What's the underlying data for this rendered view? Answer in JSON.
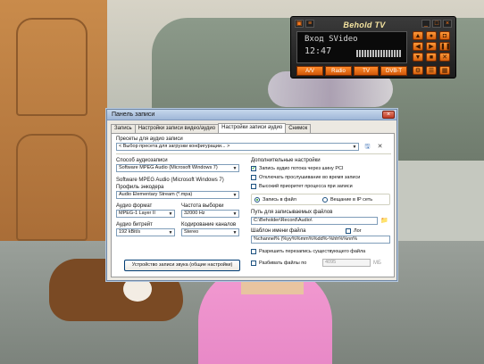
{
  "tv_panel": {
    "title": "Behold TV",
    "input": "Вход SVideo",
    "time": "12:47",
    "buttons": [
      "A/V",
      "Radio",
      "TV",
      "DVB-T"
    ]
  },
  "dialog": {
    "title": "Панель записи",
    "tabs": [
      "Запись",
      "Настройки записи видео/аудио",
      "Настройки записи аудио",
      "Снимок"
    ],
    "active_tab": 2,
    "presets_label": "Пресеты для аудио записи",
    "presets_value": "< Выбор пресета для загрузки конфигурации... >",
    "method_label": "Способ аудиозаписи",
    "method_value": "Software MPEG Audio (Microsoft Windows 7)",
    "encoder_title": "Software MPEG Audio (Microsoft Windows 7)",
    "encoder_profile_label": "Профиль энкодера",
    "encoder_profile_value": "Audio Elementary Stream (*.mpa)",
    "audio_format_label": "Аудио формат",
    "audio_format_value": "MPEG-1 Layer II",
    "sample_rate_label": "Частота выборки",
    "sample_rate_value": "32000 Hz",
    "bitrate_label": "Аудио битрейт",
    "bitrate_value": "192 kBit/s",
    "channels_label": "Кодирование каналов",
    "channels_value": "Stereo",
    "device_button": "Устройство записи звука (общие настройки)",
    "extra_label": "Дополнительные настройки",
    "chk_pci": "Запись аудио потока через шину PCI",
    "chk_pci_checked": true,
    "chk_monitor": "Отключать прослушивание во время записи",
    "chk_priority": "Высокий приоритет процесса при записи",
    "radio_file": "Запись в файл",
    "radio_ip": "Вещание в IP сеть",
    "path_label": "Путь для записываемых файлов",
    "path_value": "C:\\Beholder\\Record\\Audio\\",
    "template_label": "Шаблон имени файла",
    "log_label": "Лог",
    "template_value": "%channel% (%yy%%mm%%dd%-%hh%%nn%",
    "chk_overwrite": "Разрешить перезапись существующего файла",
    "chk_split": "Разбивать файлы по",
    "split_value": "4095",
    "split_unit": "МБ"
  }
}
